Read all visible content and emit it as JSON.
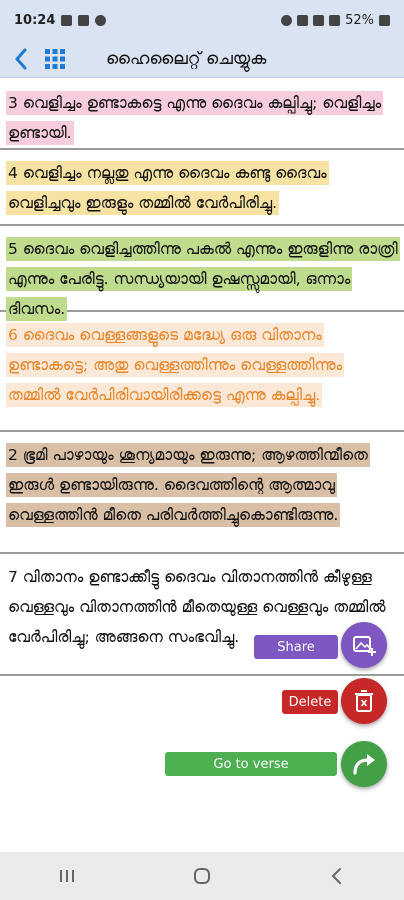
{
  "status_bar": {
    "time": "10:24",
    "battery": "52%",
    "left_icons": [
      "image-icon",
      "m-icon",
      "lock-icon"
    ],
    "right_icons": [
      "alarm-icon",
      "mute-icon",
      "wifi-icon",
      "signal-icon"
    ]
  },
  "app_bar": {
    "title": "ഹൈലൈറ്റ് ചെയ്യുക",
    "back_icon": "chevron-left-icon",
    "grid_icon": "grid-icon",
    "accent": "#1e7ad6"
  },
  "verses": [
    {
      "text": "3  വെളിച്ചം ഉണ്ടാകട്ടെ എന്നു ദൈവം കല്പിച്ചു; വെളിച്ചം ഉണ്ടായി.",
      "highlight": "#f7cddd",
      "color": "#111111"
    },
    {
      "text": "4  വെളിച്ചം നല്ലതു എന്നു ദൈവം കണ്ടു ദൈവം വെളിച്ചവും ഇരുളും തമ്മിൽ വേർപിരിച്ചു.",
      "highlight": "#f6e3a3",
      "color": "#111111"
    },
    {
      "text": "5  ദൈവം വെളിച്ചത്തിന്നു പകൽ എന്നും ഇരുളിന്നു രാത്രി എന്നും പേരിട്ടു. സന്ധ്യയായി ഉഷസ്സുമായി, ഒന്നാം ദിവസം.",
      "highlight": "#bfdc8e",
      "color": "#111111"
    },
    {
      "text": "6  ദൈവം വെള്ളങ്ങളുടെ മദ്ധ്യേ ഒരു വിതാനം ഉണ്ടാകട്ടെ; അതു വെള്ളത്തിന്നും വെള്ളത്തിന്നും തമ്മിൽ വേർപിരിവായിരിക്കട്ടെ എന്നു കല്പിച്ചു.",
      "highlight": "#fbe8d6",
      "color": "#e8862a"
    },
    {
      "text": "2  ഭൂമി പാഴായും ശൂന്യമായും ഇരുന്നു; ആഴത്തിന്മീതെ ഇരുൾ ഉണ്ടായിരുന്നു. ദൈവത്തിന്റെ ആത്മാവു വെള്ളത്തിൻ മീതെ പരിവർത്തിച്ചുകൊണ്ടിരുന്നു.",
      "highlight": "#d8bfa6",
      "color": "#111111"
    },
    {
      "text": "7  വിതാനം ഉണ്ടാക്കീട്ടു ദൈവം വിതാനത്തിൻ കീഴുള്ള വെള്ളവും വിതാനത്തിൻ മീതെയുള്ള വെള്ളവും തമ്മിൽ വേർപിരിച്ചു; അങ്ങനെ സംഭവിച്ചു.",
      "highlight": "",
      "color": "#111111"
    }
  ],
  "actions": {
    "share": {
      "label": "Share",
      "icon": "add-image-icon",
      "color": "#7e57c2"
    },
    "delete": {
      "label": "Delete",
      "icon": "trash-icon",
      "color": "#c62828"
    },
    "goto": {
      "label": "Go to verse",
      "icon": "forward-arrow-icon",
      "color": "#43a047"
    }
  },
  "nav_bar": {
    "icons": [
      "recent-apps-icon",
      "home-icon",
      "back-icon"
    ]
  }
}
